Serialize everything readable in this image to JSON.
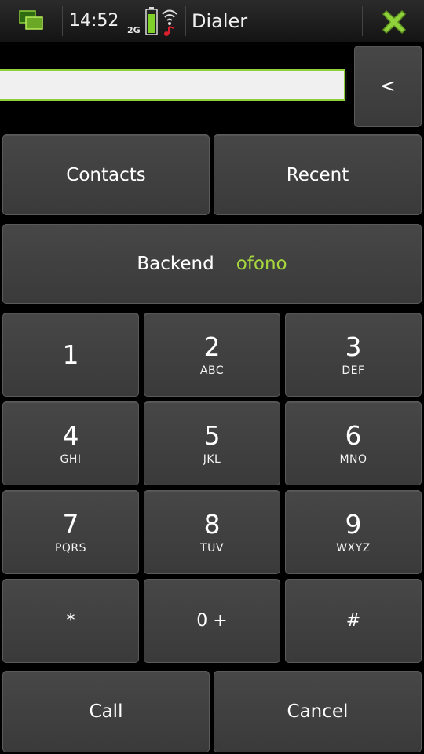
{
  "statusbar": {
    "time": "14:52",
    "network": "2G",
    "app_title": "Dialer",
    "icons": [
      "task-switcher-icon",
      "battery-icon",
      "wifi-icon",
      "close-icon"
    ],
    "accent_color": "#8fd13a"
  },
  "dialer": {
    "number_value": "",
    "backspace_label": "<",
    "contacts_label": "Contacts",
    "recent_label": "Recent",
    "backend_label": "Backend",
    "backend_value": "ofono",
    "backend_value_color": "#a6d83e"
  },
  "keypad": [
    {
      "digit": "1",
      "letters": ""
    },
    {
      "digit": "2",
      "letters": "ABC"
    },
    {
      "digit": "3",
      "letters": "DEF"
    },
    {
      "digit": "4",
      "letters": "GHI"
    },
    {
      "digit": "5",
      "letters": "JKL"
    },
    {
      "digit": "6",
      "letters": "MNO"
    },
    {
      "digit": "7",
      "letters": "PQRS"
    },
    {
      "digit": "8",
      "letters": "TUV"
    },
    {
      "digit": "9",
      "letters": "WXYZ"
    },
    {
      "digit": "*",
      "letters": ""
    },
    {
      "digit": "0 +",
      "letters": ""
    },
    {
      "digit": "#",
      "letters": ""
    }
  ],
  "actions": {
    "call_label": "Call",
    "cancel_label": "Cancel"
  }
}
